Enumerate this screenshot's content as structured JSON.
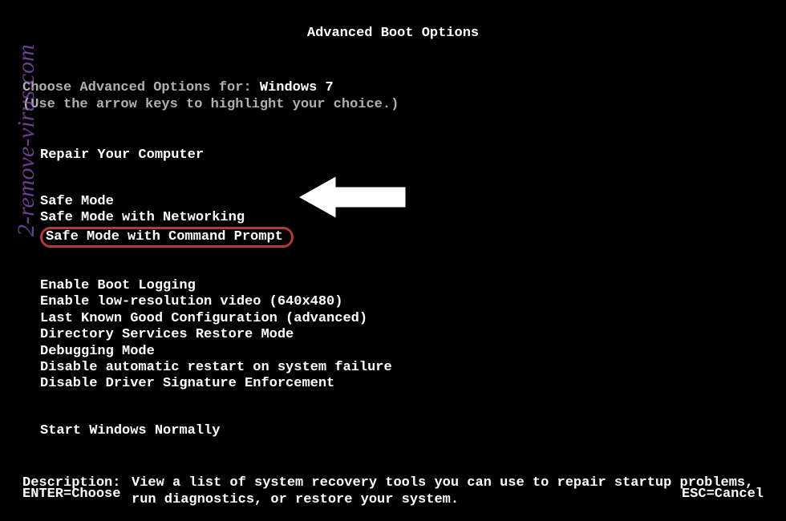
{
  "title": "Advanced Boot Options",
  "choose_label": "Choose Advanced Options for: ",
  "os_name": "Windows 7",
  "hint": "(Use the arrow keys to highlight your choice.)",
  "groups": {
    "g1": {
      "items": [
        "Repair Your Computer"
      ]
    },
    "g2": {
      "items": [
        "Safe Mode",
        "Safe Mode with Networking",
        "Safe Mode with Command Prompt"
      ]
    },
    "g3": {
      "items": [
        "Enable Boot Logging",
        "Enable low-resolution video (640x480)",
        "Last Known Good Configuration (advanced)",
        "Directory Services Restore Mode",
        "Debugging Mode",
        "Disable automatic restart on system failure",
        "Disable Driver Signature Enforcement"
      ]
    },
    "g4": {
      "items": [
        "Start Windows Normally"
      ]
    }
  },
  "desc_label": "Description:",
  "desc_text": "View a list of system recovery tools you can use to repair startup problems, run diagnostics, or restore your system.",
  "footer": {
    "enter": "ENTER=Choose",
    "esc": "ESC=Cancel"
  },
  "watermark": "2-remove-virus.com"
}
